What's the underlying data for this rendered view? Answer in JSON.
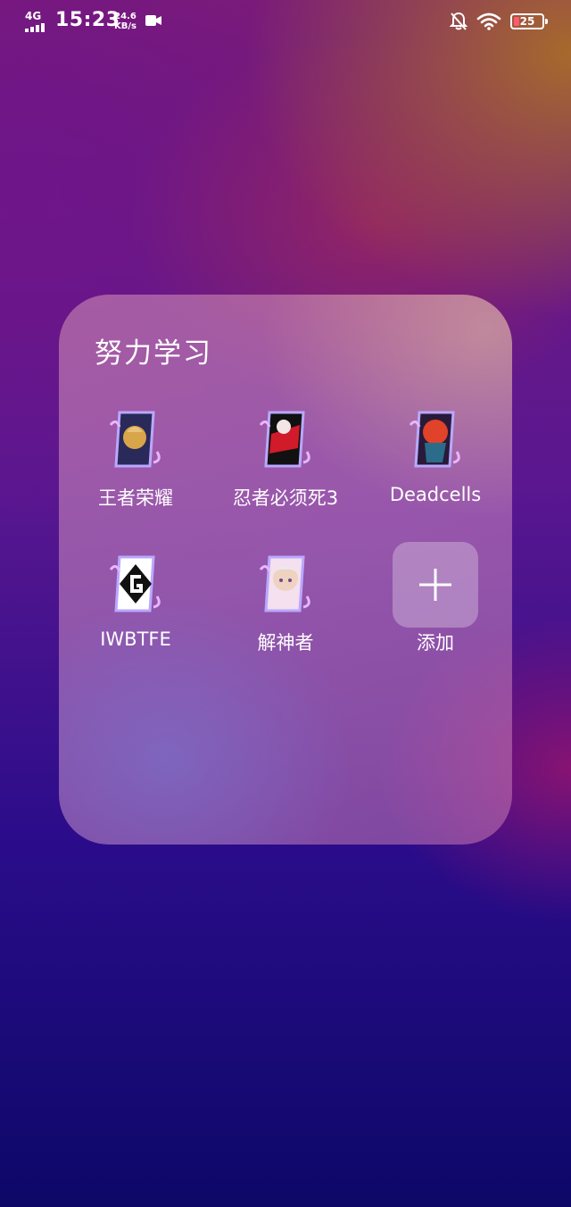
{
  "status_bar": {
    "network_type": "4G",
    "time": "15:23",
    "speed_value": "24.6",
    "speed_unit": "KB/s",
    "battery_level": "25",
    "battery_color": "#ff5b6e",
    "icons": [
      "signal-icon",
      "video-camera-icon",
      "bell-off-icon",
      "wifi-icon",
      "battery-icon"
    ]
  },
  "folder": {
    "title": "努力学习",
    "apps": [
      {
        "label": "王者荣耀",
        "accent": "#d9a54a"
      },
      {
        "label": "忍者必须死3",
        "accent": "#d11a2a"
      },
      {
        "label": "Deadcells",
        "accent": "#e0422a"
      },
      {
        "label": "IWBTFE",
        "accent": "#222222"
      },
      {
        "label": "解神者",
        "accent": "#f0d2c0"
      }
    ],
    "add_label": "添加"
  }
}
